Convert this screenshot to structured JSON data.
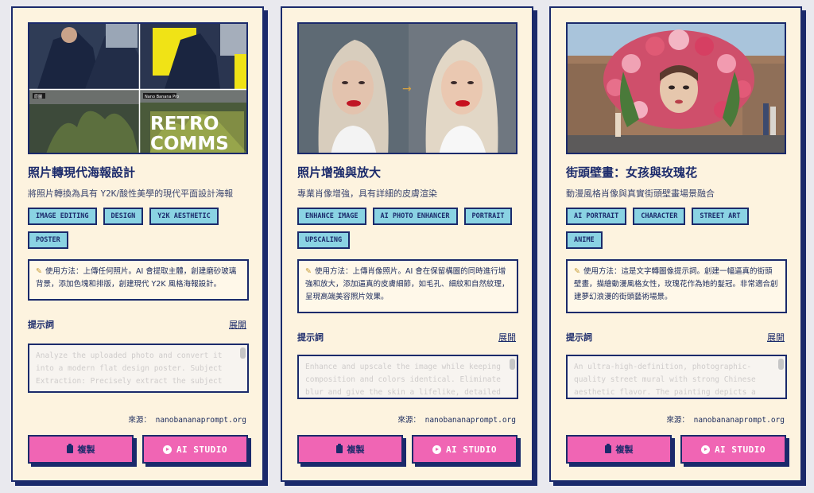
{
  "cards": [
    {
      "title": "照片轉現代海報設計",
      "subtitle_pre": "將照片轉換為具有 ",
      "subtitle_mono": "Y2K",
      "subtitle_post": "/酸性美學的現代平面設計海報",
      "tags": [
        "IMAGE EDITING",
        "DESIGN",
        "Y2K AESTHETIC",
        "POSTER"
      ],
      "usage": "使用方法：上傳任何照片。AI 會提取主體，創建磨砂玻璃背景，添加色塊和排版，創建現代 Y2K 風格海報設計。",
      "prompt_label": "提示詞",
      "expand_label": "展開",
      "prompt_text": "Analyze the uploaded photo and convert it into a modern flat design poster. Subject Extraction: Precisely extract the subject",
      "source": "來源： nanobananaprompt.org",
      "copy_label": "複製",
      "studio_label": "AI STUDIO",
      "image_texts": [
        "RETRO",
        "COMMS",
        "原圖",
        "Nano Banana Pro"
      ]
    },
    {
      "title": "照片增強與放大",
      "subtitle_pre": "專業肖像增強，具有詳細的皮膚渲染",
      "subtitle_mono": "",
      "subtitle_post": "",
      "tags": [
        "ENHANCE IMAGE",
        "AI PHOTO ENHANCER",
        "PORTRAIT",
        "UPSCALING"
      ],
      "usage": "使用方法：上傳肖像照片。AI 會在保留構圖的同時進行增強和放大，添加逼真的皮膚細節，如毛孔、細紋和自然紋理，呈現高端美容照片效果。",
      "prompt_label": "提示詞",
      "expand_label": "展開",
      "prompt_text": "Enhance and upscale the image while keeping composition and colors identical. Eliminate blur and give the skin a lifelike, detailed",
      "source": "來源： nanobananaprompt.org",
      "copy_label": "複製",
      "studio_label": "AI STUDIO"
    },
    {
      "title": "街頭壁畫：女孩與玫瑰花",
      "subtitle_pre": "動漫風格肖像與真實街頭壁畫場景融合",
      "subtitle_mono": "",
      "subtitle_post": "",
      "tags": [
        "AI PORTRAIT",
        "CHARACTER",
        "STREET ART",
        "ANIME"
      ],
      "usage": "使用方法：這是文字轉圖像提示詞。創建一幅逼真的街頭壁畫，描繪動漫風格女性，玫瑰花作為她的髮冠。非常適合創建夢幻浪漫的街頭藝術場景。",
      "prompt_label": "提示詞",
      "expand_label": "展開",
      "prompt_text": "An ultra-high-definition, photographic-quality street mural with strong Chinese aesthetic flavor. The painting depicts a",
      "source": "來源： nanobananaprompt.org",
      "copy_label": "複製",
      "studio_label": "AI STUDIO"
    }
  ],
  "colors": {
    "card_bg": "#fdf3df",
    "border": "#1b2a6b",
    "tag_bg": "#8ad3e3",
    "button_bg": "#f065b4"
  }
}
